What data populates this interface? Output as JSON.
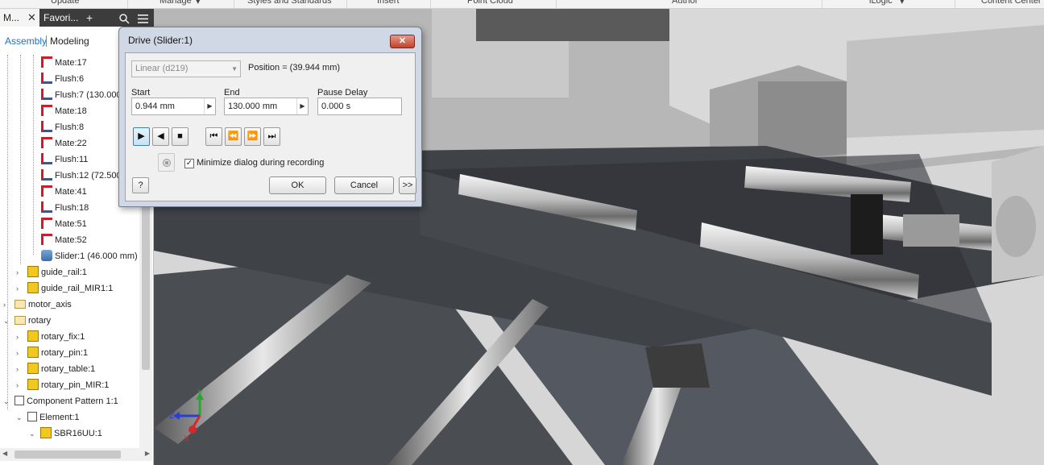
{
  "ribbon": {
    "tabs": [
      "Update",
      "Manage",
      "Styles and Standards",
      "Insert",
      "Point Cloud",
      "Author",
      "iLogic",
      "Content Center"
    ]
  },
  "browser": {
    "tab_model": "M...",
    "tab_favorites": "Favori...",
    "tab_close": "✕",
    "add_icon": "+",
    "search_icon": "search-icon",
    "menu_icon": "hamburger-icon",
    "mode_assembly": "Assembly",
    "mode_modeling": "Modeling",
    "tree": [
      {
        "label": "Mate:17",
        "icon": "mate"
      },
      {
        "label": "Flush:6",
        "icon": "flush"
      },
      {
        "label": "Flush:7 (130.000",
        "icon": "flush"
      },
      {
        "label": "Mate:18",
        "icon": "mate"
      },
      {
        "label": "Flush:8",
        "icon": "flush"
      },
      {
        "label": "Mate:22",
        "icon": "mate"
      },
      {
        "label": "Flush:11",
        "icon": "flush"
      },
      {
        "label": "Flush:12 (72.500",
        "icon": "flush"
      },
      {
        "label": "Mate:41",
        "icon": "mate"
      },
      {
        "label": "Flush:18",
        "icon": "flush"
      },
      {
        "label": "Mate:51",
        "icon": "mate"
      },
      {
        "label": "Mate:52",
        "icon": "mate"
      },
      {
        "label": "Slider:1 (46.000 mm)",
        "icon": "slider"
      },
      {
        "label": "guide_rail:1",
        "icon": "part"
      },
      {
        "label": "guide_rail_MIR1:1",
        "icon": "part"
      },
      {
        "label": "motor_axis",
        "icon": "folder"
      },
      {
        "label": "rotary",
        "icon": "folder"
      },
      {
        "label": "rotary_fix:1",
        "icon": "part"
      },
      {
        "label": "rotary_pin:1",
        "icon": "part"
      },
      {
        "label": "rotary_table:1",
        "icon": "part"
      },
      {
        "label": "rotary_pin_MIR:1",
        "icon": "part"
      },
      {
        "label": "Component Pattern 1:1",
        "icon": "pattern"
      },
      {
        "label": "Element:1",
        "icon": "pattern"
      },
      {
        "label": "SBR16UU:1",
        "icon": "part"
      }
    ]
  },
  "dialog": {
    "title": "Drive (Slider:1)",
    "close_label": "✕",
    "constraint_select": "Linear (d219)",
    "position_text": "Position = (39.944 mm)",
    "start_label": "Start",
    "start_value": "0.944 mm",
    "end_label": "End",
    "end_value": "130.000 mm",
    "pause_label": "Pause Delay",
    "pause_value": "0.000 s",
    "play_forward": "▶",
    "play_reverse": "◀",
    "stop": "■",
    "goto_start": "⏮",
    "step_back": "⏪",
    "step_forward": "⏩",
    "goto_end": "⏭",
    "minimize_label": "Minimize dialog during recording",
    "minimize_checked": "✓",
    "help_label": "?",
    "ok_label": "OK",
    "cancel_label": "Cancel",
    "more_label": ">>"
  },
  "viewcube": {
    "x_label": "X",
    "y_label": "Y",
    "z_label": "Z"
  }
}
